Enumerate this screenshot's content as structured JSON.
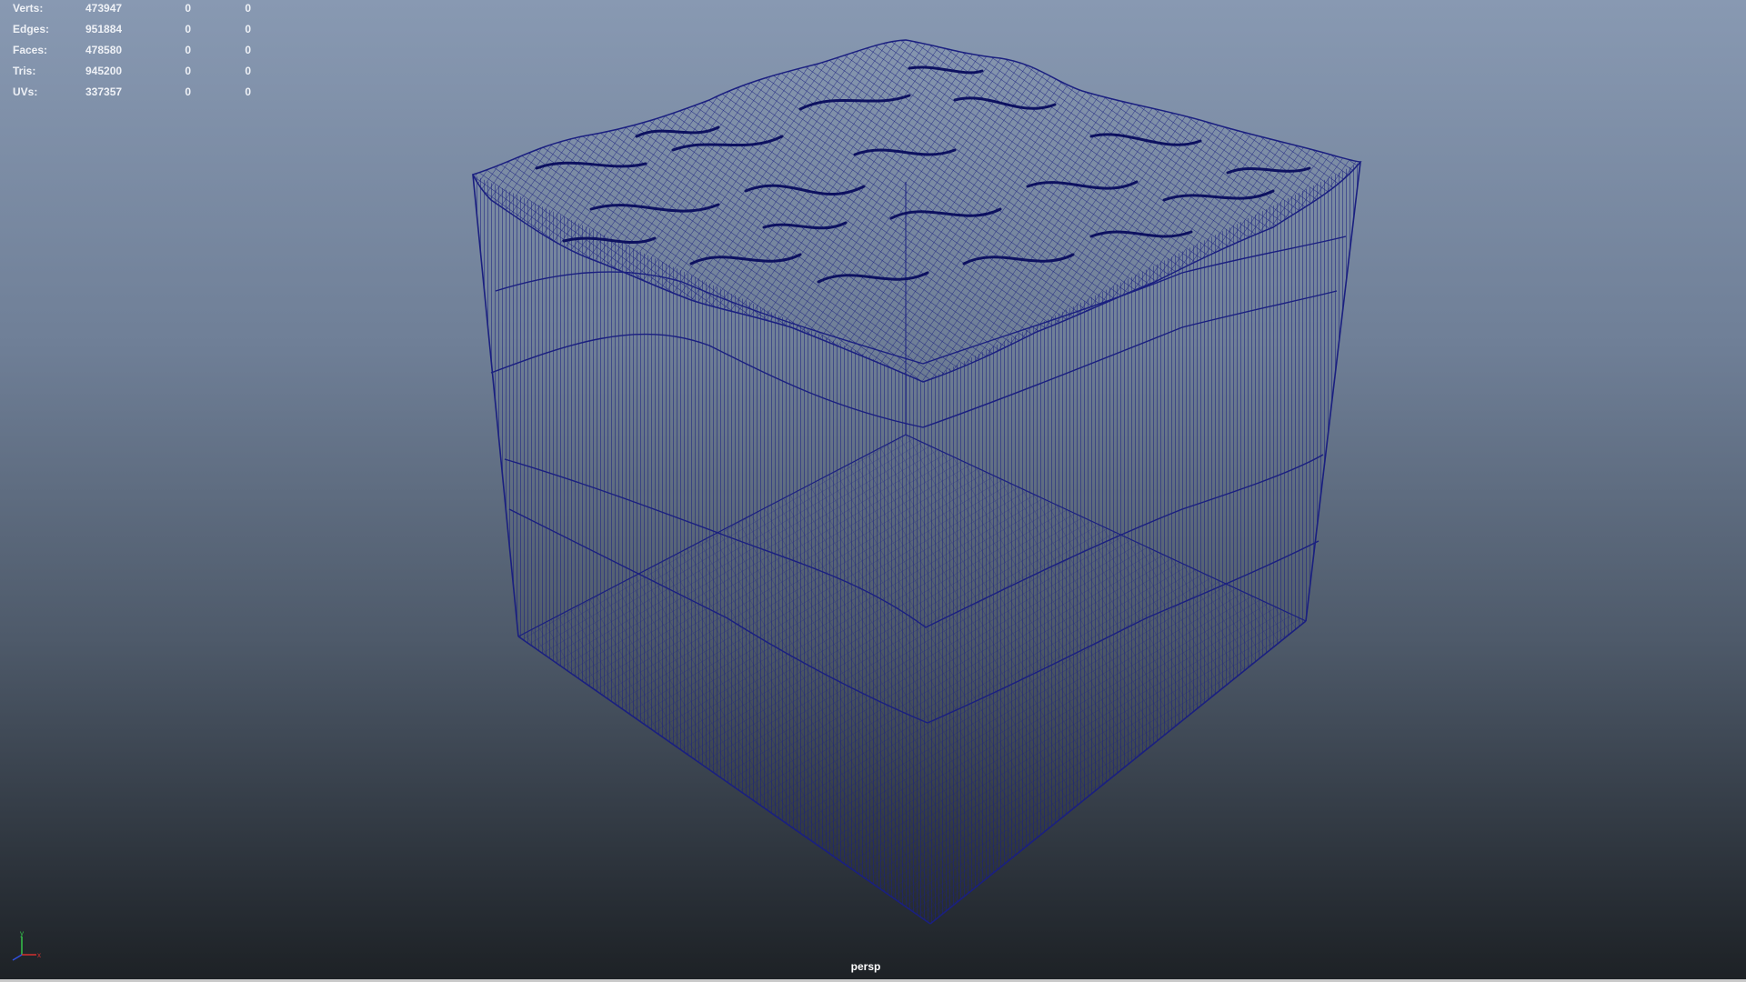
{
  "hud": {
    "rows": [
      {
        "label": "Verts:",
        "total": "473947",
        "selected": "0",
        "components": "0"
      },
      {
        "label": "Edges:",
        "total": "951884",
        "selected": "0",
        "components": "0"
      },
      {
        "label": "Faces:",
        "total": "478580",
        "selected": "0",
        "components": "0"
      },
      {
        "label": "Tris:",
        "total": "945200",
        "selected": "0",
        "components": "0"
      },
      {
        "label": "UVs:",
        "total": "337357",
        "selected": "0",
        "components": "0"
      }
    ]
  },
  "viewport": {
    "camera_label": "persp"
  },
  "axis": {
    "x": "x",
    "y": "y"
  },
  "colors": {
    "wire": "#1a1f80",
    "wire_dark": "#0d1160",
    "text": "#eef1f6"
  }
}
